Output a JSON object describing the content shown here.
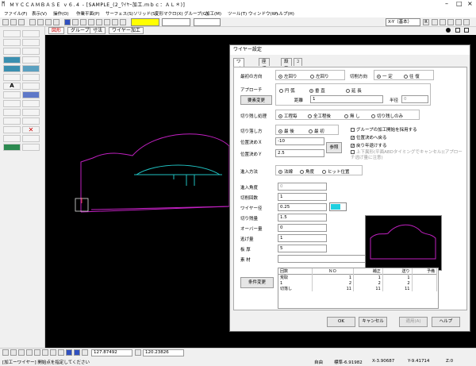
{
  "window": {
    "title": "ＭＹＣＣＡＭＢＡＳＥ ｖ６.４ - [SAMPLE_(2_ﾜｲﾔｰ加工.ｍｂｃ：ＡＬ＊)]",
    "logo": "ᛗ"
  },
  "menu": [
    "ファイル(F)",
    "表示(V)",
    "操作(O)",
    "作業平面(P)",
    "サーフェス(S)",
    "ソリッド(S)",
    "変形マクロ(X)",
    "グループ(G)",
    "加工(M)",
    "ツール(T)",
    "ウィンドウ(W)",
    "ヘルプ(H)"
  ],
  "toolbar": {
    "view_select": "X-Y（基本）",
    "view_button": "R"
  },
  "canvas_tabs": [
    "図形",
    "グループ",
    "寸法",
    "ワイヤー加工"
  ],
  "status": {
    "prompt": "[加工ーワイヤー] 開始点を指定してください",
    "coord_x_field": "127.87492",
    "coord_y_field": "120.23826",
    "mode": "自由",
    "pitch": "標準-6.91982",
    "x": "X-3.90687",
    "y": "Y-9.41714",
    "z": "Z:0"
  },
  "dialog": {
    "title": "ワイヤー設定",
    "tabs": [
      "ワイヤー",
      "座標系",
      "設定",
      "ｺｰﾅｰ"
    ],
    "cut_direction_label": "最初の方向",
    "cut_dir_options": [
      "左回り",
      "左回り"
    ],
    "direction_label": "切削方向",
    "direction_options": [
      "一 定",
      "往 復"
    ],
    "approach_label": "アプローチ",
    "approach_options": [
      "円 弧",
      "垂 直",
      "延 長"
    ],
    "approach_change": "要素変更",
    "distance_label": "距離",
    "distance_value": "1",
    "radius_label": "半径",
    "radius_value": "0",
    "cutoff_label": "切り残し処理",
    "cutoff_options": [
      "工程毎",
      "全工程後",
      "無 し",
      "切り残しのみ"
    ],
    "cut_order_label": "切り落し方",
    "cut_order_options": [
      "最 後",
      "最 初"
    ],
    "checks": [
      "グループの加工開始を採用する",
      "位置決めへ戻る",
      "戻り年退けする",
      "上下異形(平面ABDタイミングでキャンセル)(アプローチ逃げ量に注意)"
    ],
    "posx_label": "位置決めＸ",
    "posx_value": "-10",
    "posy_label": "位置決めＹ",
    "posy_value": "2.5",
    "ref_button": "参照",
    "entry_label": "進入方法",
    "entry_options": [
      "法線",
      "角度",
      "ヒット位置"
    ],
    "entry_angle_label": "進入角度",
    "entry_angle_value": "0",
    "cut_count_label": "切削回数",
    "cut_count_value": "1",
    "wire_dia_label": "ワイヤー径",
    "wire_dia_value": "0.25",
    "wire_color": "#20d0e0",
    "remain_label": "切り残量",
    "remain_value": "1.5",
    "over_label": "オーバー量",
    "over_value": "0",
    "escape_label": "逃げ量",
    "escape_value": "1",
    "thickness_label": "板 厚",
    "thickness_value": "5",
    "material_label": "素 材",
    "material_value": "",
    "cond_button": "条件変更",
    "table_headers": [
      "回数",
      "ＮＯ",
      "補正",
      "送り",
      "予備"
    ],
    "table_rows": [
      [
        "荒取",
        "1",
        "1",
        "1",
        ""
      ],
      [
        "1",
        "2",
        "2",
        "2",
        ""
      ],
      [
        "切落し",
        "11",
        "11",
        "11",
        ""
      ]
    ],
    "ok": "OK",
    "cancel": "キャンセル",
    "apply": "適用(A)",
    "help": "ヘルプ"
  }
}
